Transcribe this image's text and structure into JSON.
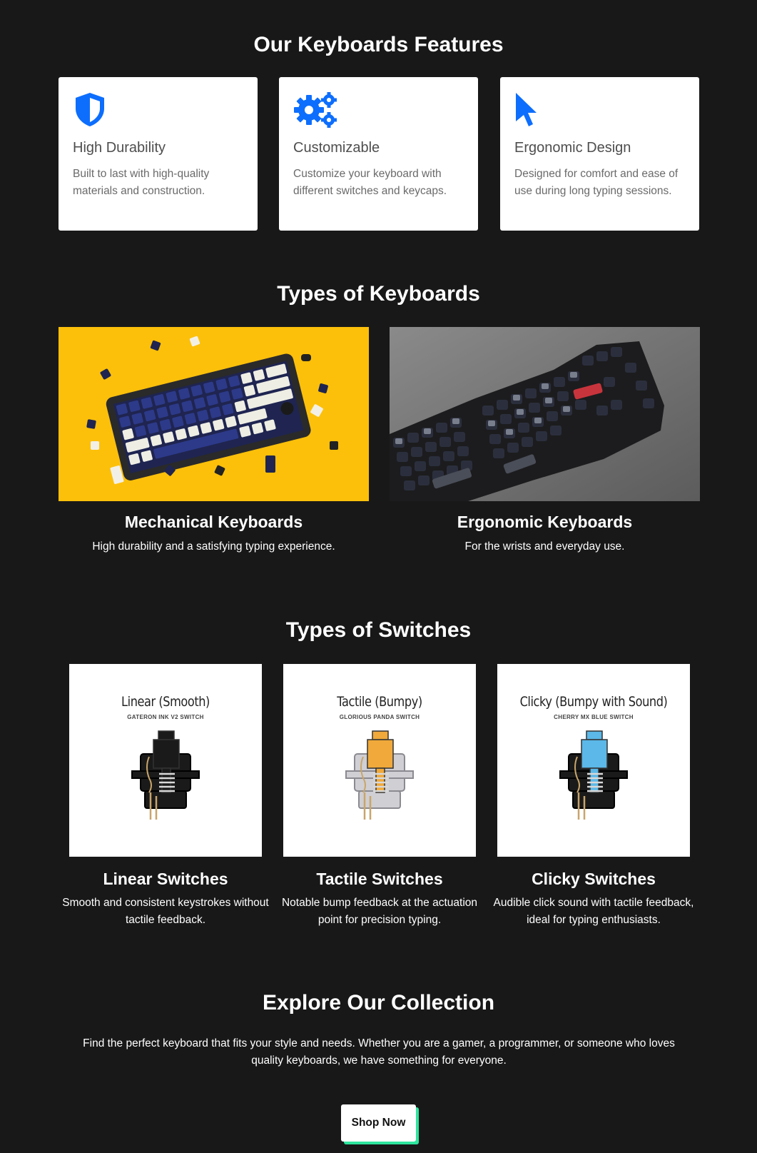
{
  "features": {
    "title": "Our Keyboards Features",
    "items": [
      {
        "icon": "shield-icon",
        "title": "High Durability",
        "text": "Built to last with high-quality materials and construction."
      },
      {
        "icon": "gears-icon",
        "title": "Customizable",
        "text": "Customize your keyboard with different switches and keycaps."
      },
      {
        "icon": "pointer-icon",
        "title": "Ergonomic Design",
        "text": "Designed for comfort and ease of use during long typing sessions."
      }
    ],
    "icon_color": "#0d6efd"
  },
  "keyboards": {
    "title": "Types of Keyboards",
    "items": [
      {
        "title": "Mechanical Keyboards",
        "text": "High durability and a satisfying typing experience."
      },
      {
        "title": "Ergonomic Keyboards",
        "text": "For the wrists and everyday use."
      }
    ]
  },
  "switches": {
    "title": "Types of Switches",
    "items": [
      {
        "image_title": "Linear (Smooth)",
        "image_subtitle": "GATERON INK V2 SWITCH",
        "title": "Linear Switches",
        "text": "Smooth and consistent keystrokes without tactile feedback.",
        "stem_color": "#1a1a1a"
      },
      {
        "image_title": "Tactile (Bumpy)",
        "image_subtitle": "GLORIOUS PANDA SWITCH",
        "title": "Tactile Switches",
        "text": "Notable bump feedback at the actuation point for precision typing.",
        "stem_color": "#f0a93a"
      },
      {
        "image_title": "Clicky (Bumpy with Sound)",
        "image_subtitle": "CHERRY MX BLUE SWITCH",
        "title": "Clicky Switches",
        "text": "Audible click sound with tactile feedback, ideal for typing enthusiasts.",
        "stem_color": "#5bb8e8"
      }
    ]
  },
  "collection": {
    "title": "Explore Our Collection",
    "text": "Find the perfect keyboard that fits your style and needs. Whether you are a gamer, a programmer, or someone who loves quality keyboards, we have something for everyone.",
    "button_label": "Shop Now",
    "button_shadow_color": "#2ee59d"
  }
}
